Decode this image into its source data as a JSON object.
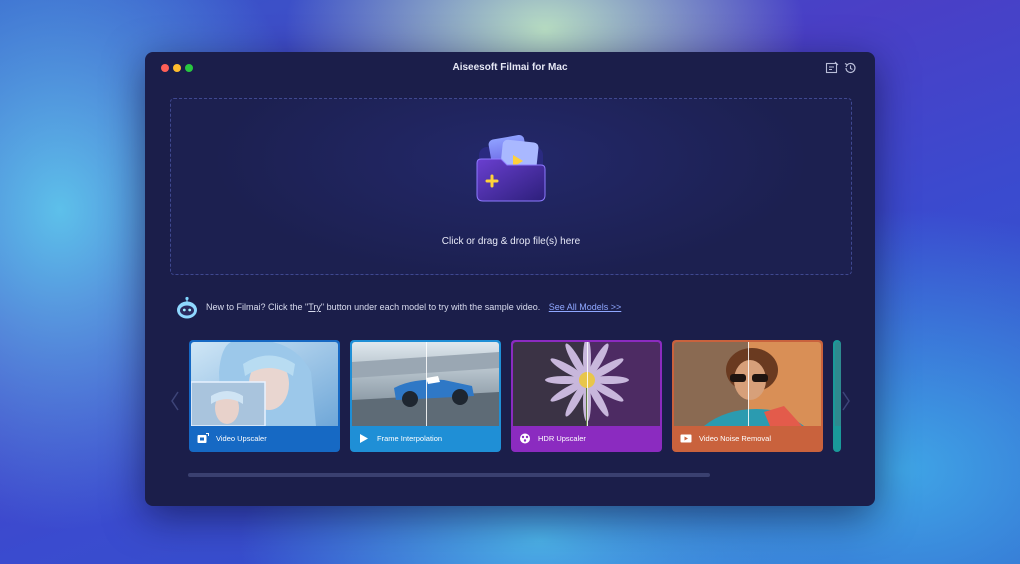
{
  "window": {
    "title": "Aiseesoft Filmai for Mac"
  },
  "dropzone": {
    "text": "Click or drag & drop file(s) here"
  },
  "hint": {
    "prefix": "New to Filmai? Click the \"",
    "try": "Try",
    "suffix": "\" button under each model to try with the sample video.",
    "see_all": "See All Models >>"
  },
  "models": [
    {
      "label": "Video Upscaler",
      "color": "#1669c4",
      "icon": "video-upscale-icon"
    },
    {
      "label": "Frame Interpolation",
      "color": "#1f8fd6",
      "icon": "play-icon"
    },
    {
      "label": "HDR Upscaler",
      "color": "#8b2bc0",
      "icon": "hdr-icon"
    },
    {
      "label": "Video Noise Removal",
      "color": "#c9623d",
      "icon": "video-noise-icon"
    }
  ],
  "colors": {
    "window_bg": "#1b1e4a",
    "link": "#8fa7ff"
  }
}
